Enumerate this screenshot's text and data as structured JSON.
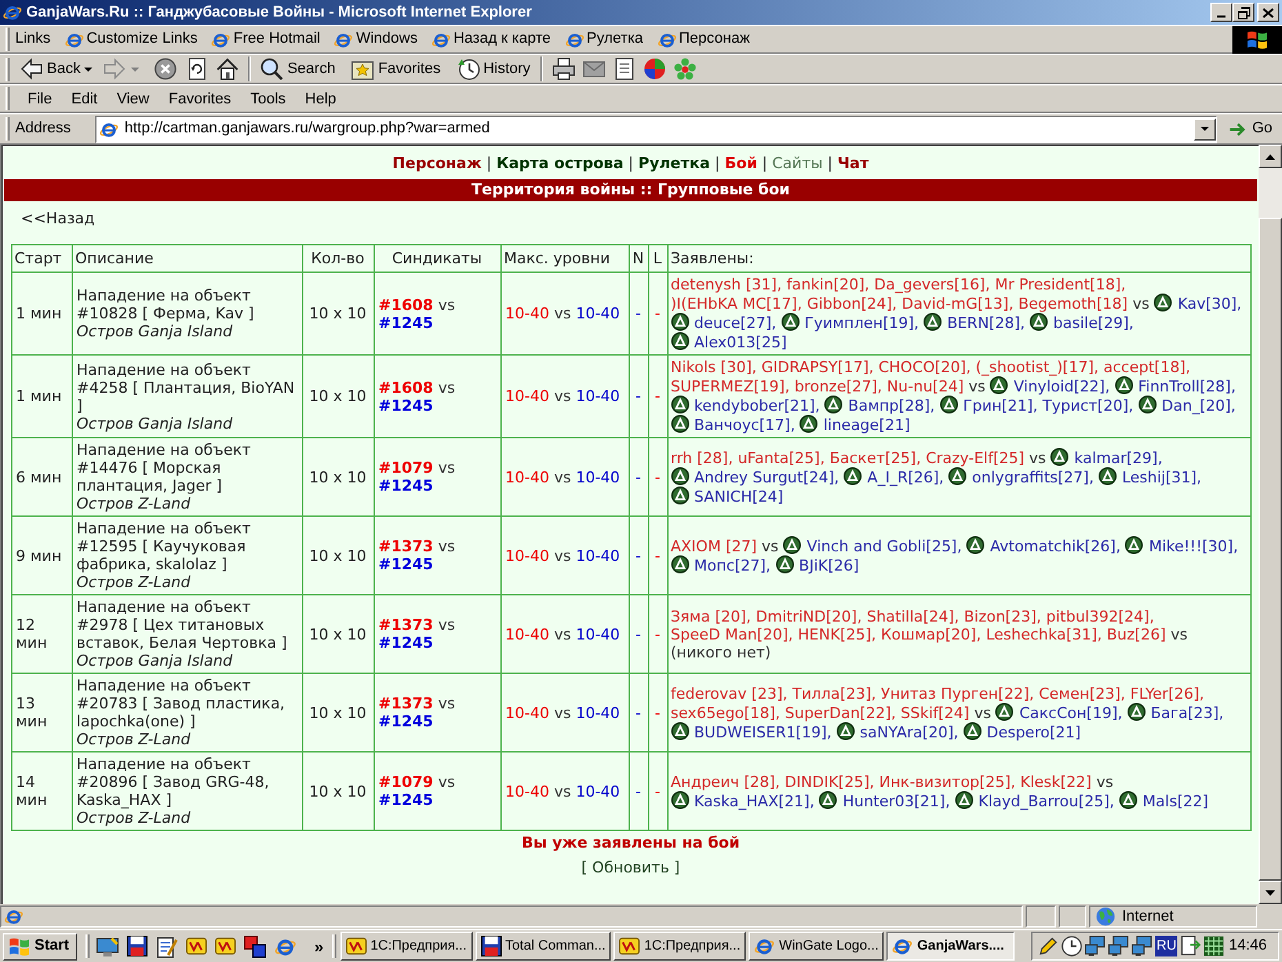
{
  "window": {
    "title": "GanjaWars.Ru :: Ганджубасовые Войны - Microsoft Internet Explorer"
  },
  "links_bar": {
    "label": "Links",
    "items": [
      "Customize Links",
      "Free Hotmail",
      "Windows",
      "Назад к карте",
      "Рулетка",
      "Персонаж"
    ]
  },
  "toolbar": {
    "back": "Back",
    "forward": {
      "disabled": true
    },
    "search": "Search",
    "favorites": "Favorites",
    "history": "History"
  },
  "menu": [
    "File",
    "Edit",
    "View",
    "Favorites",
    "Tools",
    "Help"
  ],
  "address_bar": {
    "label": "Address",
    "value": "http://cartman.ganjawars.ru/wargroup.php?war=armed",
    "go": "Go"
  },
  "page": {
    "nav": {
      "items": [
        {
          "label": "Персонаж",
          "color": "#990000",
          "bold": true
        },
        {
          "label": "Карта острова",
          "color": "#003300",
          "bold": true
        },
        {
          "label": "Рулетка",
          "color": "#003300",
          "bold": true
        },
        {
          "label": "Бой",
          "color": "#dd0000",
          "bold": true
        },
        {
          "label": "Сайты",
          "color": "#557755",
          "bold": false
        },
        {
          "label": "Чат",
          "color": "#990000",
          "bold": true
        }
      ],
      "separators": [
        "|",
        "|",
        "|",
        "|",
        "|"
      ]
    },
    "banner": "Территория войны :: Групповые бои",
    "back_link": "<<Назад",
    "table": {
      "columns": [
        "Старт",
        "Описание",
        "Кол-во",
        "Синдикаты",
        "Макс. уровни",
        "N",
        "L",
        "Заявлены:"
      ],
      "rows": [
        {
          "start": "1 мин",
          "title": "Нападение на объект #10828 [ Ферма, Kav ]",
          "island": "Остров Ganja Island",
          "size": "10 x 10",
          "syndicates": {
            "attacker": "#1608",
            "vs": "vs",
            "defender": "#1245"
          },
          "levels": {
            "attacker": "10-40",
            "vs": "vs",
            "defender": "10-40"
          },
          "n": "-",
          "l": "-",
          "applicants": {
            "attackers": [
              "detenysh [31],",
              "fankin[20],",
              "Da_gevers[16],",
              "Mr President[18],",
              ")I(EHbKA MC[17],",
              "Gibbon[24],",
              "David-mG[13],",
              "Begemoth[18]"
            ],
            "vs": "vs",
            "defenders": [
              {
                "name": "Kav[30],",
                "emblem": true
              },
              {
                "name": "deuce[27],",
                "emblem": true
              },
              {
                "name": "Гуимплен[19],",
                "emblem": true
              },
              {
                "name": "BERN[28],",
                "emblem": true
              },
              {
                "name": "basile[29],",
                "emblem": true
              },
              {
                "name": "Alex013[25]",
                "emblem": true
              }
            ]
          }
        },
        {
          "start": "1 мин",
          "title": "Нападение на объект #4258 [ Плантация, BioYAN ]",
          "island": "Остров Ganja Island",
          "size": "10 x 10",
          "syndicates": {
            "attacker": "#1608",
            "vs": "vs",
            "defender": "#1245"
          },
          "levels": {
            "attacker": "10-40",
            "vs": "vs",
            "defender": "10-40"
          },
          "n": "-",
          "l": "-",
          "applicants": {
            "attackers": [
              "Nikols [30],",
              "GIDRAPSY[17],",
              "CHOCO[20],",
              "(_shootist_)[17],",
              "accept[18],",
              "SUPERMEZ[19],",
              "bronze[27],",
              "Nu-nu[24]"
            ],
            "vs": "vs",
            "defenders": [
              {
                "name": "Vinyloid[22],",
                "emblem": true
              },
              {
                "name": "FinnTroll[28],",
                "emblem": true
              },
              {
                "name": "kendybober[21],",
                "emblem": true
              },
              {
                "name": "Вампр[28],",
                "emblem": true
              },
              {
                "name": "Грин[21],",
                "emblem": true
              },
              {
                "name": "Турист[20],",
                "emblem": false
              },
              {
                "name": "Dan_[20],",
                "emblem": true
              },
              {
                "name": "Ванчоус[17],",
                "emblem": true
              },
              {
                "name": "lineage[21]",
                "emblem": true
              }
            ]
          }
        },
        {
          "start": "6 мин",
          "title": "Нападение на объект #14476 [ Морская плантация, Jager ]",
          "island": "Остров Z-Land",
          "size": "10 x 10",
          "syndicates": {
            "attacker": "#1079",
            "vs": "vs",
            "defender": "#1245"
          },
          "levels": {
            "attacker": "10-40",
            "vs": "vs",
            "defender": "10-40"
          },
          "n": "-",
          "l": "-",
          "applicants": {
            "attackers": [
              "rrh [28],",
              "uFanta[25],",
              "Баскет[25],",
              "Crazy-Elf[25]"
            ],
            "vs": "vs",
            "defenders": [
              {
                "name": "kalmar[29],",
                "emblem": true
              },
              {
                "name": "Andrey Surgut[24],",
                "emblem": true
              },
              {
                "name": "A_I_R[26],",
                "emblem": true
              },
              {
                "name": "onlygraffits[27],",
                "emblem": true
              },
              {
                "name": "Leshij[31],",
                "emblem": true
              },
              {
                "name": "SANICH[24]",
                "emblem": true
              }
            ]
          }
        },
        {
          "start": "9 мин",
          "title": "Нападение на объект #12595 [ Каучуковая фабрика, skalolaz ]",
          "island": "Остров Z-Land",
          "size": "10 x 10",
          "syndicates": {
            "attacker": "#1373",
            "vs": "vs",
            "defender": "#1245"
          },
          "levels": {
            "attacker": "10-40",
            "vs": "vs",
            "defender": "10-40"
          },
          "n": "-",
          "l": "-",
          "applicants": {
            "attackers": [
              "AXIOM [27]"
            ],
            "vs": "vs",
            "defenders": [
              {
                "name": "Vinch and Gobli[25],",
                "emblem": true
              },
              {
                "name": "Avtomatchik[26],",
                "emblem": true
              },
              {
                "name": "Mike!!![30],",
                "emblem": true
              },
              {
                "name": "Мопс[27],",
                "emblem": true
              },
              {
                "name": "BJiK[26]",
                "emblem": true
              }
            ]
          }
        },
        {
          "start": "12 мин",
          "title": "Нападение на объект #2978 [ Цех титановых вставок, Белая Чертовка ]",
          "island": "Остров Ganja Island",
          "size": "10 x 10",
          "syndicates": {
            "attacker": "#1373",
            "vs": "vs",
            "defender": "#1245"
          },
          "levels": {
            "attacker": "10-40",
            "vs": "vs",
            "defender": "10-40"
          },
          "n": "-",
          "l": "-",
          "applicants": {
            "attackers": [
              "Зяма [20],",
              "DmitriND[20],",
              "Shatilla[24],",
              "Bizon[23],",
              "pitbul392[24],",
              "SpeeD Man[20],",
              "HENK[25],",
              "Кошмар[20],",
              "Leshechka[31],",
              "Buz[26]"
            ],
            "vs": "vs",
            "none": "(никого нет)"
          }
        },
        {
          "start": "13 мин",
          "title": "Нападение на объект #20783 [ Завод пластика, lapochka(one) ]",
          "island": "Остров Z-Land",
          "size": "10 x 10",
          "syndicates": {
            "attacker": "#1373",
            "vs": "vs",
            "defender": "#1245"
          },
          "levels": {
            "attacker": "10-40",
            "vs": "vs",
            "defender": "10-40"
          },
          "n": "-",
          "l": "-",
          "applicants": {
            "attackers": [
              "federovav [23],",
              "Тилла[23],",
              "Унитаз Пурген[22],",
              "Семен[23],",
              "FLYer[26],",
              "sex65ego[18],",
              "SuperDan[22],",
              "SSkif[24]"
            ],
            "vs": "vs",
            "defenders": [
              {
                "name": "СаксСон[19],",
                "emblem": true
              },
              {
                "name": "Бага[23],",
                "emblem": true
              },
              {
                "name": "BUDWEISER1[19],",
                "emblem": true
              },
              {
                "name": "saNYAra[20],",
                "emblem": true
              },
              {
                "name": "Despero[21]",
                "emblem": true
              }
            ]
          }
        },
        {
          "start": "14 мин",
          "title": "Нападение на объект #20896 [ Завод GRG-48, Kaska_HAX ]",
          "island": "Остров Z-Land",
          "size": "10 x 10",
          "syndicates": {
            "attacker": "#1079",
            "vs": "vs",
            "defender": "#1245"
          },
          "levels": {
            "attacker": "10-40",
            "vs": "vs",
            "defender": "10-40"
          },
          "n": "-",
          "l": "-",
          "applicants": {
            "attackers": [
              "Андреич [28],",
              "DINDIK[25],",
              "Инк-визитор[25],",
              "Klesk[22]"
            ],
            "vs": "vs",
            "defenders": [
              {
                "name": "Kaska_HAX[21],",
                "emblem": true
              },
              {
                "name": "Hunter03[21],",
                "emblem": true
              },
              {
                "name": "Klayd_Barrou[25],",
                "emblem": true
              },
              {
                "name": "Mals[22]",
                "emblem": true
              }
            ]
          }
        }
      ]
    },
    "notice": "Вы уже заявлены на бой",
    "refresh": "[ Обновить ]"
  },
  "status_bar": {
    "zone": "Internet"
  },
  "taskbar": {
    "start": "Start",
    "more": "»",
    "tasks": [
      {
        "label": "1С:Предприя...",
        "kind": "app",
        "selected": false
      },
      {
        "label": "Total Comman...",
        "kind": "disk",
        "selected": false
      },
      {
        "label": "1С:Предприя...",
        "kind": "app",
        "selected": false
      },
      {
        "label": "WinGate Logo...",
        "kind": "browser",
        "selected": false
      },
      {
        "label": "GanjaWars....",
        "kind": "browser",
        "selected": true
      }
    ],
    "language": "RU",
    "clock": "14:46"
  }
}
